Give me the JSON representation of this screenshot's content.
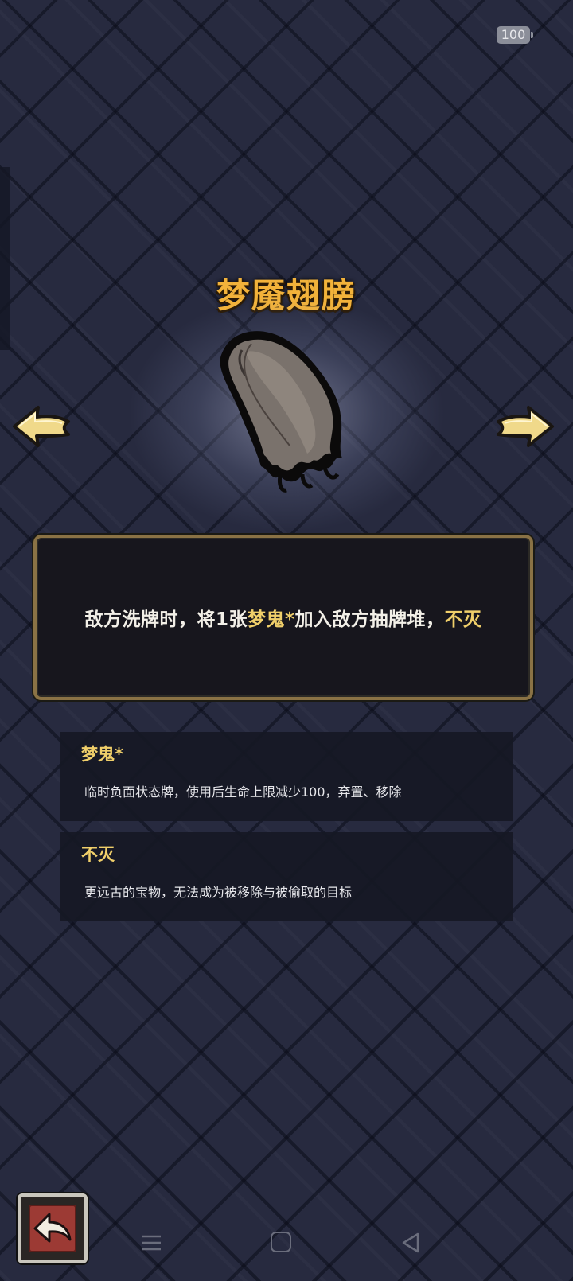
{
  "status_bar": {
    "battery": "100"
  },
  "item": {
    "name": "梦魇翅膀",
    "image_icon": "tattered-wing-icon"
  },
  "description": {
    "part1": "敌方洗牌时，将1张",
    "highlight1": "梦鬼*",
    "part2": "加入敌方抽牌堆，",
    "highlight2": "不灭"
  },
  "keywords": [
    {
      "title": "梦鬼*",
      "text": "临时负面状态牌，使用后生命上限减少100，弃置、移除"
    },
    {
      "title": "不灭",
      "text": "更远古的宝物，无法成为被移除与被偷取的目标"
    }
  ],
  "navigation": {
    "prev_icon": "arrow-left-icon",
    "next_icon": "arrow-right-icon",
    "back_icon": "return-arrow-icon"
  },
  "system_nav": [
    "menu-icon",
    "home-icon",
    "back-triangle-icon"
  ],
  "colors": {
    "title": "#f2b23a",
    "highlight": "#f0cf6a",
    "box_border": "#8a7245",
    "back_button": "#9c3a34"
  }
}
